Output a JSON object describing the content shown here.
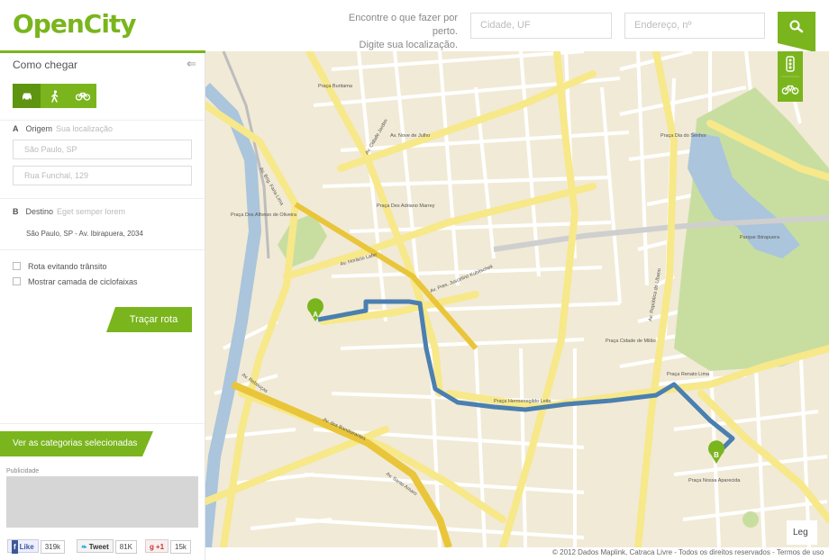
{
  "header": {
    "logo": "OpenCity",
    "hint_line1": "Encontre o que fazer por perto.",
    "hint_line2": "Digite sua localização.",
    "city_placeholder": "Cidade, UF",
    "address_placeholder": "Endereço, nº"
  },
  "sidebar": {
    "title": "Como chegar",
    "origin": {
      "letter": "A",
      "label": "Origem",
      "hint": "Sua localização",
      "city_placeholder": "São Paulo, SP",
      "street_placeholder": "Rua Funchal, 129"
    },
    "destination": {
      "letter": "B",
      "label": "Destino",
      "hint": "Eget semper lorem",
      "value": "São Paulo, SP - Av. Ibirapuera, 2034"
    },
    "options": [
      {
        "label": "Rota evitando trânsito"
      },
      {
        "label": "Mostrar camada de ciclofaixas"
      }
    ],
    "route_button": "Traçar rota",
    "categories_button": "Ver as categorias selecionadas",
    "ad_label": "Publicidade"
  },
  "social": {
    "like_label": "Like",
    "like_count": "319k",
    "tweet_label": "Tweet",
    "tweet_count": "81K",
    "gplus_label": "+1",
    "gplus_count": "15k"
  },
  "map": {
    "marker_a": "A",
    "marker_b": "B",
    "legend_button": "Leg",
    "copyright": "© 2012 Dados Maplink, Catraca Livre - Todos os direitos reservados - Termos de uso",
    "labels": [
      "Av. Nove de Julho",
      "Av. Pres. Juscelino Kubitschek",
      "Av. República do Líbano",
      "Av. Brig. Faria Lima",
      "Av. Cidade Jardim",
      "Av. Horácio Lafer",
      "Av. Rebouças",
      "Av. dos Bandeirantes",
      "Av. Santo Amaro",
      "Praça Buritama",
      "Praça Dos Alfonso de Oliveira",
      "Praça Des Adriano Marrey",
      "Praça Hermenegildo Leite",
      "Praça Renato Lima",
      "Praça Cidade de Milão",
      "Praça Nossa Aparecida",
      "Parque Ibirapuera",
      "Praça Dia do Senhor"
    ]
  },
  "colors": {
    "accent": "#7ab51d",
    "route": "#4a7fb0",
    "road_major": "#f7e88a",
    "park": "#c8dea1",
    "water": "#aac5dc"
  }
}
